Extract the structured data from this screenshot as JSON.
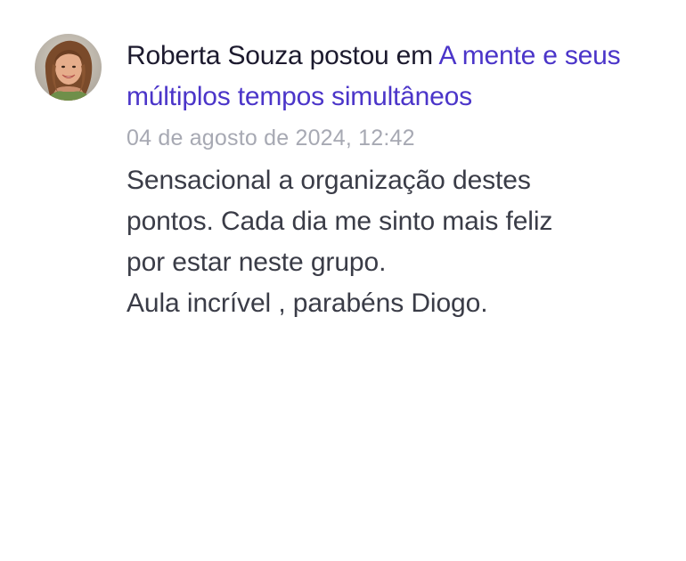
{
  "post": {
    "author": "Roberta Souza",
    "action": "postou em",
    "topic": "A mente e seus múltiplos tempos simultâneos",
    "timestamp": "04 de agosto de 2024, 12:42",
    "body_lines": [
      "Sensacional a organização destes",
      "pontos. Cada dia me sinto mais feliz",
      "por estar neste grupo.",
      "Aula incrível , parabéns Diogo."
    ]
  },
  "colors": {
    "link": "#4b35c9",
    "text_dark": "#1c1a2e",
    "text_body": "#3a3c47",
    "text_muted": "#a7a9b3"
  }
}
